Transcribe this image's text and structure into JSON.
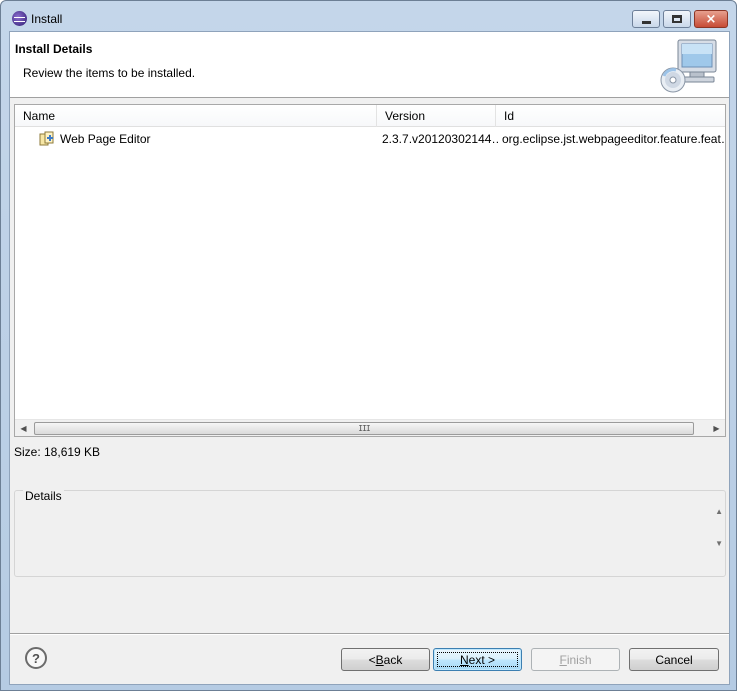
{
  "window": {
    "title": "Install",
    "controls": {
      "minimize": "minimize",
      "maximize": "maximize",
      "close": "×"
    }
  },
  "header": {
    "title": "Install Details",
    "subtitle": "Review the items to be installed.",
    "graphic_icon": "computer-with-cd-icon"
  },
  "table": {
    "columns": [
      "Name",
      "Version",
      "Id"
    ],
    "rows": [
      {
        "name": "Web Page Editor",
        "version": "2.3.7.v20120302144…",
        "id": "org.eclipse.jst.webpageeditor.feature.feat…",
        "icon": "feature-plugin-icon"
      }
    ],
    "scrollbar_grip": "III"
  },
  "size": {
    "label": "Size: 18,619 KB"
  },
  "details": {
    "label": "Details",
    "text": ""
  },
  "buttons": {
    "back_prefix": "< ",
    "back_key": "B",
    "back_rest": "ack",
    "next_key": "N",
    "next_rest": "ext >",
    "finish_key": "F",
    "finish_rest": "inish",
    "cancel": "Cancel",
    "help_glyph": "?"
  },
  "colors": {
    "frame": "#b5cbe3",
    "client": "#f0f0f0",
    "close_button": "#c74c36",
    "default_button": "#bee6fd"
  }
}
